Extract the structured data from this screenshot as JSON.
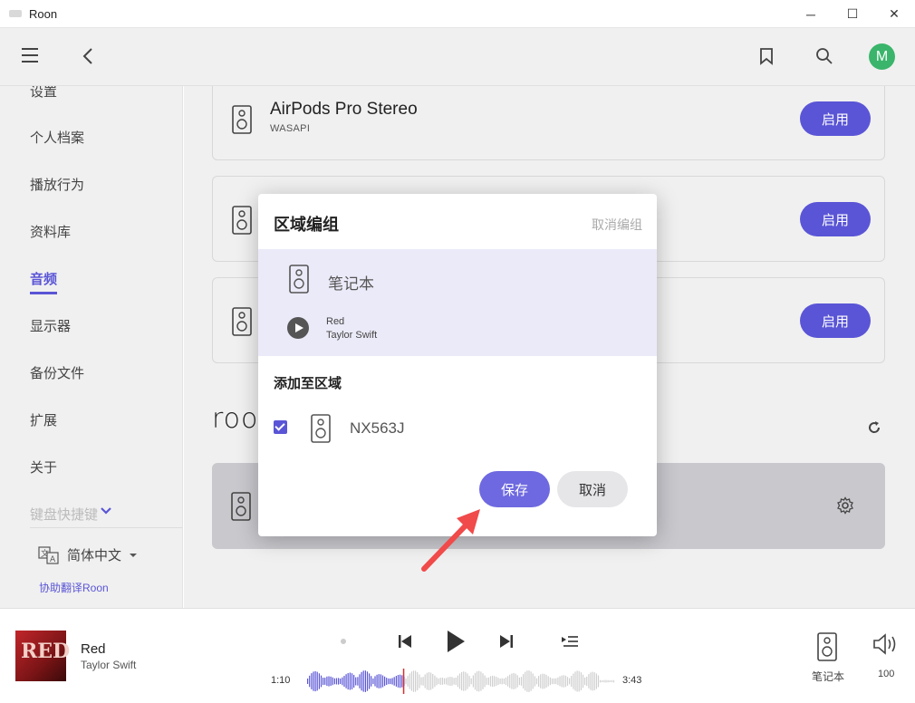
{
  "window": {
    "title": "Roon",
    "minimize": "─",
    "maximize": "☐",
    "close": "✕"
  },
  "header": {
    "avatar_letter": "M",
    "avatar_color": "#3ab56b"
  },
  "sidebar": {
    "items": [
      {
        "label": "设置"
      },
      {
        "label": "个人档案"
      },
      {
        "label": "播放行为"
      },
      {
        "label": "资料库"
      },
      {
        "label": "音频"
      },
      {
        "label": "显示器"
      },
      {
        "label": "备份文件"
      },
      {
        "label": "扩展"
      },
      {
        "label": "关于"
      },
      {
        "label": "键盘快捷键"
      }
    ],
    "language": "简体中文",
    "translate_link": "协助翻译Roon"
  },
  "main": {
    "devices": [
      {
        "name": "AirPods Pro Stereo",
        "sub": "WASAPI",
        "button": "启用"
      },
      {
        "name": "",
        "sub": "",
        "button": "启用"
      },
      {
        "name": "",
        "sub": "",
        "button": "启用"
      }
    ],
    "roon_logo": "roo"
  },
  "dialog": {
    "title": "区域编组",
    "ungroup": "取消编组",
    "zone_name": "笔记本",
    "track_title": "Red",
    "track_artist": "Taylor Swift",
    "add_title": "添加至区域",
    "device_name": "NX563J",
    "device_checked": true,
    "save": "保存",
    "cancel": "取消"
  },
  "player": {
    "album_art_text": "RED",
    "title": "Red",
    "artist": "Taylor Swift",
    "elapsed": "1:10",
    "duration": "3:43",
    "progress": 0.314,
    "zone": "笔记本",
    "volume": "100"
  },
  "colors": {
    "accent": "#5a55d6",
    "save_button": "#6e69e0",
    "annotation_arrow": "#f04a4a"
  }
}
